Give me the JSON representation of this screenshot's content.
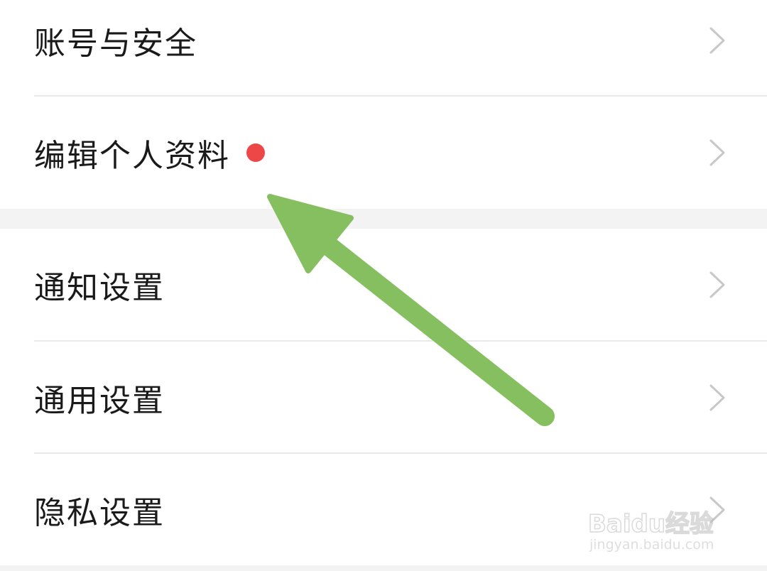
{
  "settings_group_1": [
    {
      "label": "账号与安全",
      "has_badge": false
    },
    {
      "label": "编辑个人资料",
      "has_badge": true
    }
  ],
  "settings_group_2": [
    {
      "label": "通知设置",
      "has_badge": false
    },
    {
      "label": "通用设置",
      "has_badge": false
    },
    {
      "label": "隐私设置",
      "has_badge": false
    }
  ],
  "icons": {
    "row_chevron": "chevron-right-icon",
    "badge": "red-dot-badge",
    "annotation": "green-arrow-icon"
  },
  "colors": {
    "badge": "#ee4747",
    "annotation_arrow": "#86bf60",
    "section_gap": "#f3f3f3",
    "divider": "#e9e9e9",
    "chevron": "#c8c8c8"
  },
  "watermark": {
    "brand": "Baidu经验",
    "url": "jingyan.baidu.com"
  }
}
